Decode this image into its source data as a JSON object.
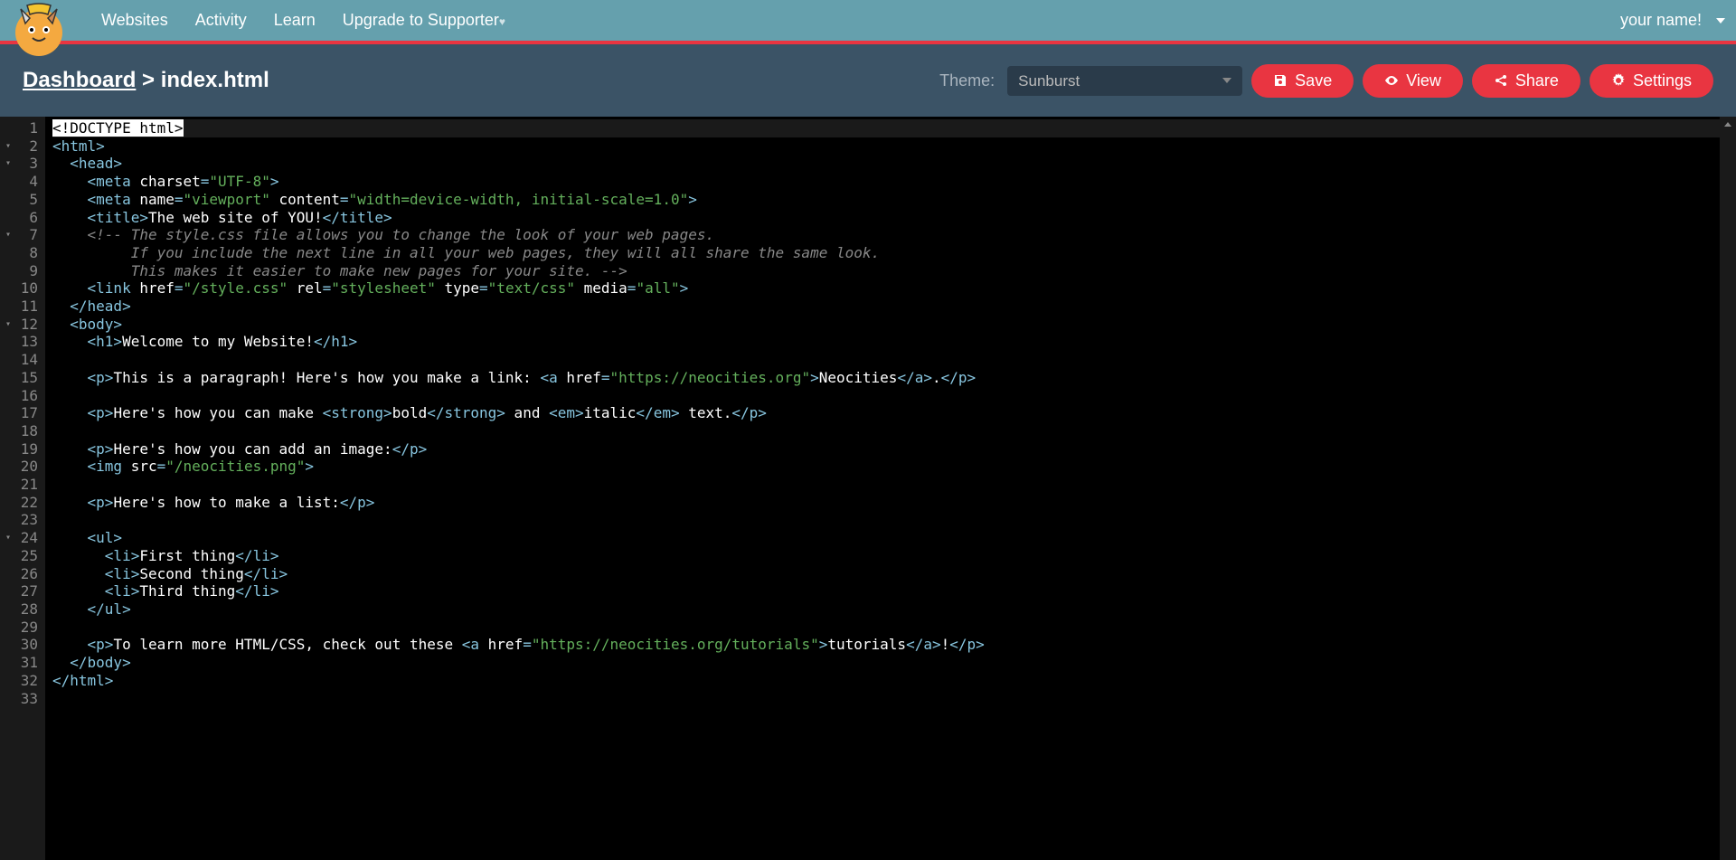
{
  "nav": {
    "links": [
      "Websites",
      "Activity",
      "Learn",
      "Upgrade to Supporter"
    ],
    "username": "your name!"
  },
  "header": {
    "breadcrumb_dashboard": "Dashboard",
    "breadcrumb_sep": " > ",
    "breadcrumb_file": "index.html",
    "theme_label": "Theme:",
    "theme_value": "Sunburst",
    "save": "Save",
    "view": "View",
    "share": "Share",
    "settings": "Settings"
  },
  "editor": {
    "line_count": 33,
    "fold_lines": [
      2,
      3,
      7,
      12,
      24
    ],
    "code_lines": [
      {
        "t": "doctype",
        "raw": "<!DOCTYPE html>"
      },
      {
        "t": "tag",
        "parts": [
          {
            "k": "tag",
            "v": "<html>"
          }
        ]
      },
      {
        "t": "tag",
        "parts": [
          {
            "k": "sp",
            "v": "  "
          },
          {
            "k": "tag",
            "v": "<head>"
          }
        ]
      },
      {
        "t": "tag",
        "parts": [
          {
            "k": "sp",
            "v": "    "
          },
          {
            "k": "tag",
            "v": "<meta "
          },
          {
            "k": "attr",
            "v": "charset"
          },
          {
            "k": "tag",
            "v": "="
          },
          {
            "k": "str",
            "v": "\"UTF-8\""
          },
          {
            "k": "tag",
            "v": ">"
          }
        ]
      },
      {
        "t": "tag",
        "parts": [
          {
            "k": "sp",
            "v": "    "
          },
          {
            "k": "tag",
            "v": "<meta "
          },
          {
            "k": "attr",
            "v": "name"
          },
          {
            "k": "tag",
            "v": "="
          },
          {
            "k": "str",
            "v": "\"viewport\""
          },
          {
            "k": "attr",
            "v": " content"
          },
          {
            "k": "tag",
            "v": "="
          },
          {
            "k": "str",
            "v": "\"width=device-width, initial-scale=1.0\""
          },
          {
            "k": "tag",
            "v": ">"
          }
        ]
      },
      {
        "t": "tag",
        "parts": [
          {
            "k": "sp",
            "v": "    "
          },
          {
            "k": "tag",
            "v": "<title>"
          },
          {
            "k": "txt",
            "v": "The web site of YOU!"
          },
          {
            "k": "tag",
            "v": "</title>"
          }
        ]
      },
      {
        "t": "com",
        "parts": [
          {
            "k": "sp",
            "v": "    "
          },
          {
            "k": "com",
            "v": "<!-- The style.css file allows you to change the look of your web pages."
          }
        ]
      },
      {
        "t": "com",
        "parts": [
          {
            "k": "sp",
            "v": "         "
          },
          {
            "k": "com",
            "v": "If you include the next line in all your web pages, they will all share the same look."
          }
        ]
      },
      {
        "t": "com",
        "parts": [
          {
            "k": "sp",
            "v": "         "
          },
          {
            "k": "com",
            "v": "This makes it easier to make new pages for your site. -->"
          }
        ]
      },
      {
        "t": "tag",
        "parts": [
          {
            "k": "sp",
            "v": "    "
          },
          {
            "k": "tag",
            "v": "<link "
          },
          {
            "k": "attr",
            "v": "href"
          },
          {
            "k": "tag",
            "v": "="
          },
          {
            "k": "str",
            "v": "\"/style.css\""
          },
          {
            "k": "attr",
            "v": " rel"
          },
          {
            "k": "tag",
            "v": "="
          },
          {
            "k": "str",
            "v": "\"stylesheet\""
          },
          {
            "k": "attr",
            "v": " type"
          },
          {
            "k": "tag",
            "v": "="
          },
          {
            "k": "str",
            "v": "\"text/css\""
          },
          {
            "k": "attr",
            "v": " media"
          },
          {
            "k": "tag",
            "v": "="
          },
          {
            "k": "str",
            "v": "\"all\""
          },
          {
            "k": "tag",
            "v": ">"
          }
        ]
      },
      {
        "t": "tag",
        "parts": [
          {
            "k": "sp",
            "v": "  "
          },
          {
            "k": "tag",
            "v": "</head>"
          }
        ]
      },
      {
        "t": "tag",
        "parts": [
          {
            "k": "sp",
            "v": "  "
          },
          {
            "k": "tag",
            "v": "<body>"
          }
        ]
      },
      {
        "t": "tag",
        "parts": [
          {
            "k": "sp",
            "v": "    "
          },
          {
            "k": "tag",
            "v": "<h1>"
          },
          {
            "k": "txt",
            "v": "Welcome to my Website!"
          },
          {
            "k": "tag",
            "v": "</h1>"
          }
        ]
      },
      {
        "t": "blank"
      },
      {
        "t": "tag",
        "parts": [
          {
            "k": "sp",
            "v": "    "
          },
          {
            "k": "tag",
            "v": "<p>"
          },
          {
            "k": "txt",
            "v": "This is a paragraph! Here's how you make a link: "
          },
          {
            "k": "tag",
            "v": "<a "
          },
          {
            "k": "attr",
            "v": "href"
          },
          {
            "k": "tag",
            "v": "="
          },
          {
            "k": "str",
            "v": "\"https://neocities.org\""
          },
          {
            "k": "tag",
            "v": ">"
          },
          {
            "k": "txt",
            "v": "Neocities"
          },
          {
            "k": "tag",
            "v": "</a>"
          },
          {
            "k": "txt",
            "v": "."
          },
          {
            "k": "tag",
            "v": "</p>"
          }
        ]
      },
      {
        "t": "blank"
      },
      {
        "t": "tag",
        "parts": [
          {
            "k": "sp",
            "v": "    "
          },
          {
            "k": "tag",
            "v": "<p>"
          },
          {
            "k": "txt",
            "v": "Here's how you can make "
          },
          {
            "k": "tag",
            "v": "<strong>"
          },
          {
            "k": "txt",
            "v": "bold"
          },
          {
            "k": "tag",
            "v": "</strong>"
          },
          {
            "k": "txt",
            "v": " and "
          },
          {
            "k": "tag",
            "v": "<em>"
          },
          {
            "k": "txt",
            "v": "italic"
          },
          {
            "k": "tag",
            "v": "</em>"
          },
          {
            "k": "txt",
            "v": " text."
          },
          {
            "k": "tag",
            "v": "</p>"
          }
        ]
      },
      {
        "t": "blank"
      },
      {
        "t": "tag",
        "parts": [
          {
            "k": "sp",
            "v": "    "
          },
          {
            "k": "tag",
            "v": "<p>"
          },
          {
            "k": "txt",
            "v": "Here's how you can add an image:"
          },
          {
            "k": "tag",
            "v": "</p>"
          }
        ]
      },
      {
        "t": "tag",
        "parts": [
          {
            "k": "sp",
            "v": "    "
          },
          {
            "k": "tag",
            "v": "<img "
          },
          {
            "k": "attr",
            "v": "src"
          },
          {
            "k": "tag",
            "v": "="
          },
          {
            "k": "str",
            "v": "\"/neocities.png\""
          },
          {
            "k": "tag",
            "v": ">"
          }
        ]
      },
      {
        "t": "blank"
      },
      {
        "t": "tag",
        "parts": [
          {
            "k": "sp",
            "v": "    "
          },
          {
            "k": "tag",
            "v": "<p>"
          },
          {
            "k": "txt",
            "v": "Here's how to make a list:"
          },
          {
            "k": "tag",
            "v": "</p>"
          }
        ]
      },
      {
        "t": "blank"
      },
      {
        "t": "tag",
        "parts": [
          {
            "k": "sp",
            "v": "    "
          },
          {
            "k": "tag",
            "v": "<ul>"
          }
        ]
      },
      {
        "t": "tag",
        "parts": [
          {
            "k": "sp",
            "v": "      "
          },
          {
            "k": "tag",
            "v": "<li>"
          },
          {
            "k": "txt",
            "v": "First thing"
          },
          {
            "k": "tag",
            "v": "</li>"
          }
        ]
      },
      {
        "t": "tag",
        "parts": [
          {
            "k": "sp",
            "v": "      "
          },
          {
            "k": "tag",
            "v": "<li>"
          },
          {
            "k": "txt",
            "v": "Second thing"
          },
          {
            "k": "tag",
            "v": "</li>"
          }
        ]
      },
      {
        "t": "tag",
        "parts": [
          {
            "k": "sp",
            "v": "      "
          },
          {
            "k": "tag",
            "v": "<li>"
          },
          {
            "k": "txt",
            "v": "Third thing"
          },
          {
            "k": "tag",
            "v": "</li>"
          }
        ]
      },
      {
        "t": "tag",
        "parts": [
          {
            "k": "sp",
            "v": "    "
          },
          {
            "k": "tag",
            "v": "</ul>"
          }
        ]
      },
      {
        "t": "blank"
      },
      {
        "t": "tag",
        "parts": [
          {
            "k": "sp",
            "v": "    "
          },
          {
            "k": "tag",
            "v": "<p>"
          },
          {
            "k": "txt",
            "v": "To learn more HTML/CSS, check out these "
          },
          {
            "k": "tag",
            "v": "<a "
          },
          {
            "k": "attr",
            "v": "href"
          },
          {
            "k": "tag",
            "v": "="
          },
          {
            "k": "str",
            "v": "\"https://neocities.org/tutorials\""
          },
          {
            "k": "tag",
            "v": ">"
          },
          {
            "k": "txt",
            "v": "tutorials"
          },
          {
            "k": "tag",
            "v": "</a>"
          },
          {
            "k": "txt",
            "v": "!"
          },
          {
            "k": "tag",
            "v": "</p>"
          }
        ]
      },
      {
        "t": "tag",
        "parts": [
          {
            "k": "sp",
            "v": "  "
          },
          {
            "k": "tag",
            "v": "</body>"
          }
        ]
      },
      {
        "t": "tag",
        "parts": [
          {
            "k": "tag",
            "v": "</html>"
          }
        ]
      },
      {
        "t": "blank"
      }
    ]
  }
}
